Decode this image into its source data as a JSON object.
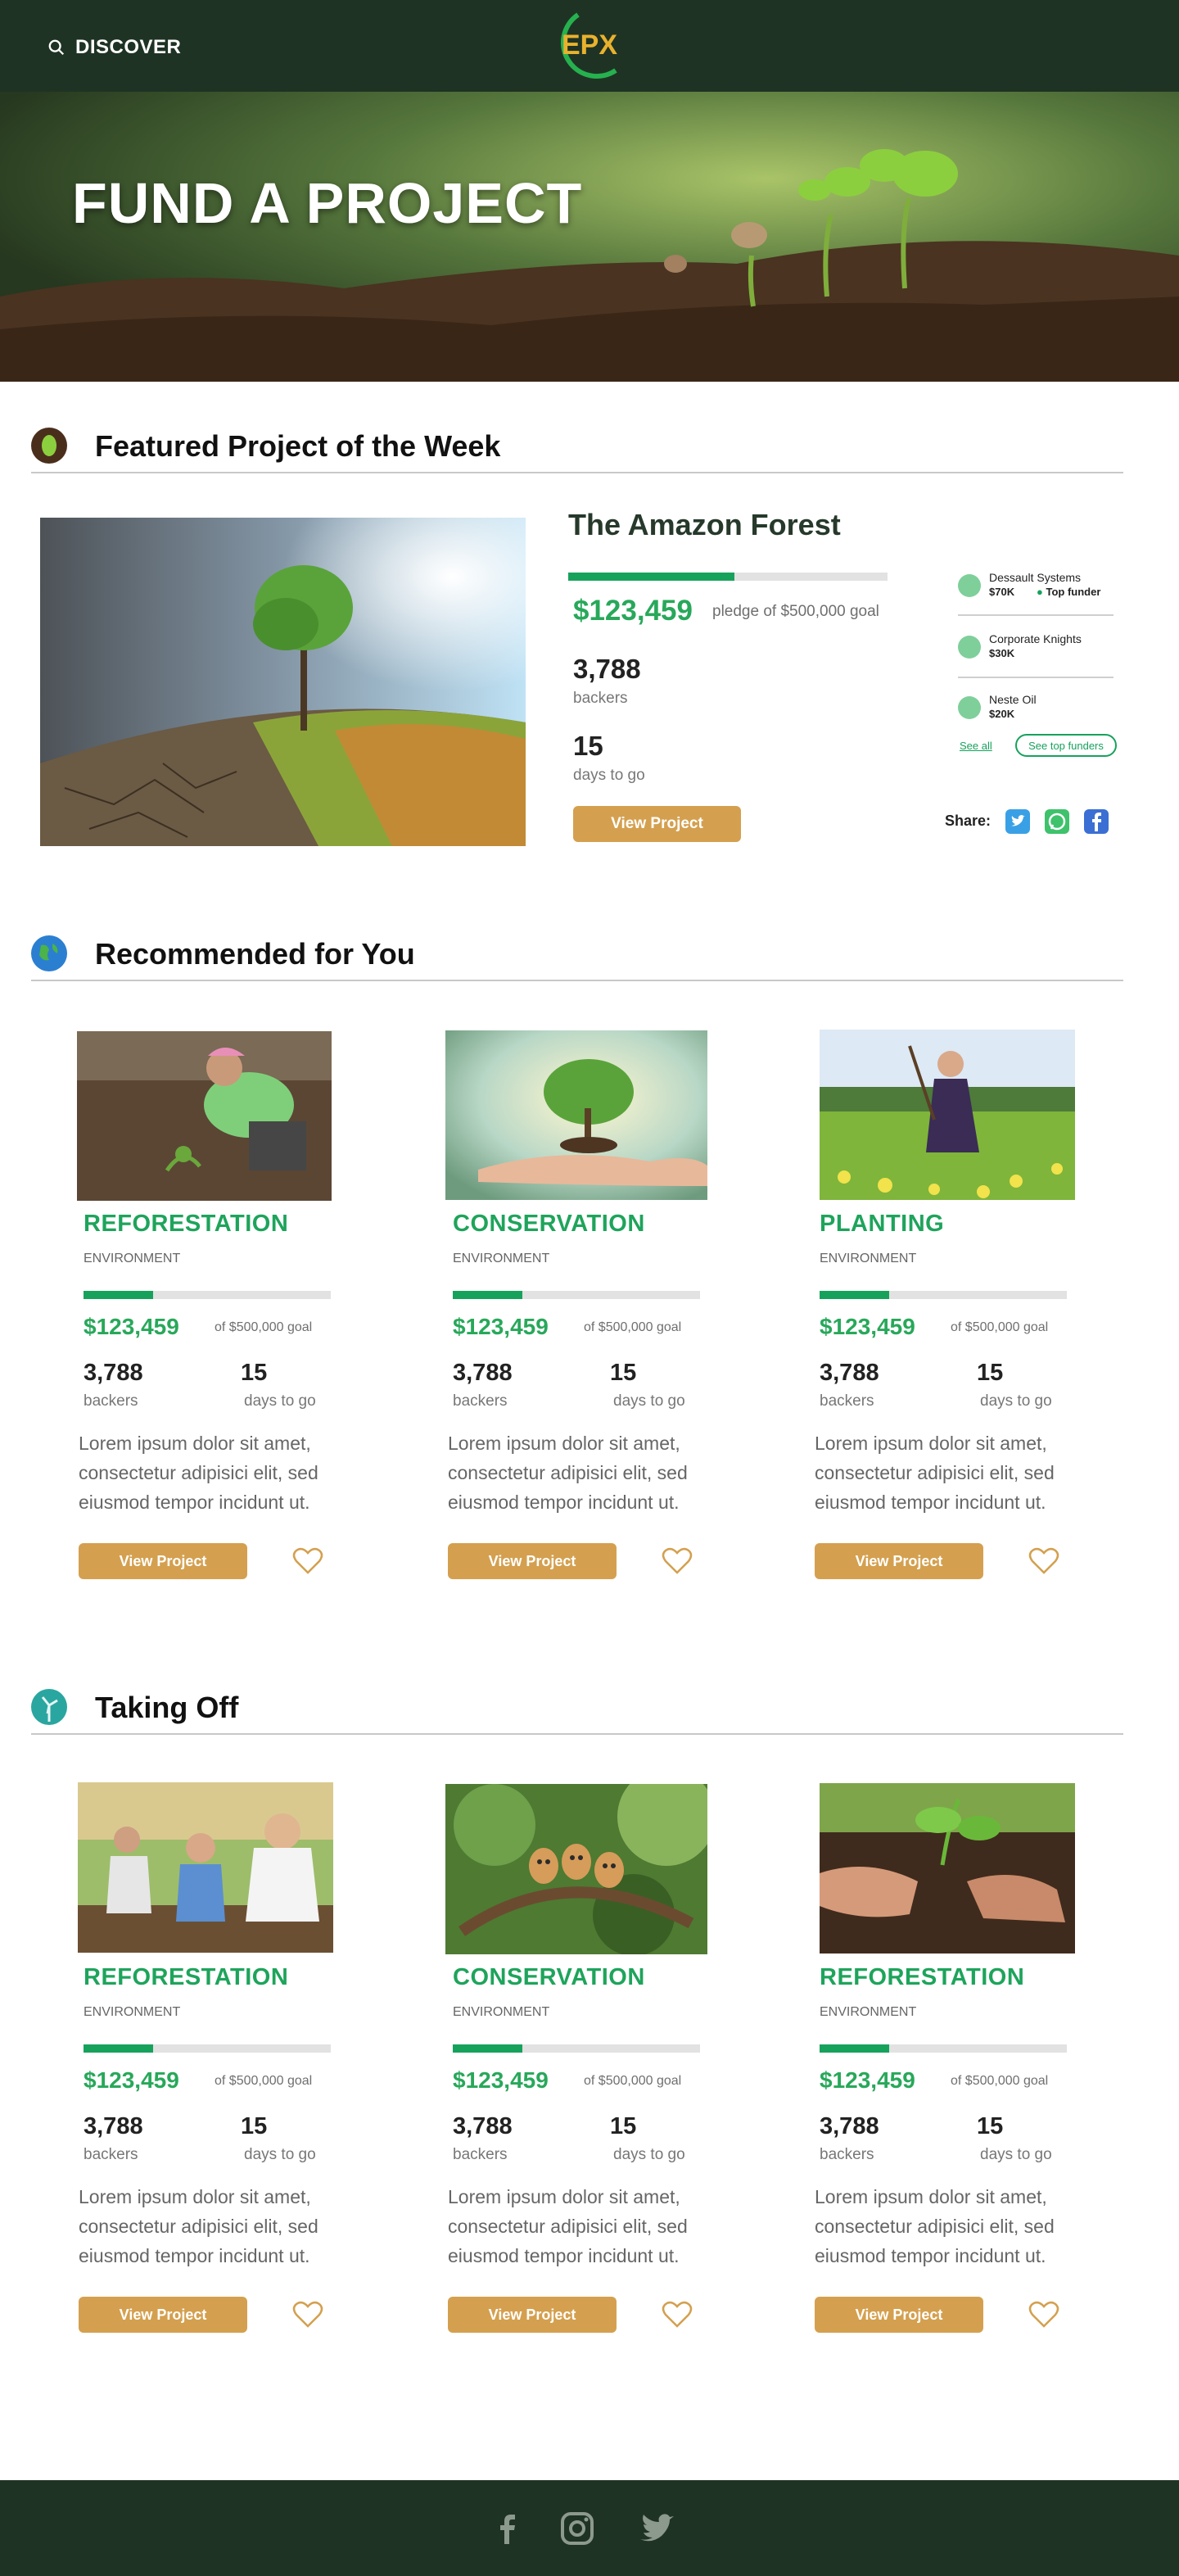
{
  "header": {
    "discover_label": "DISCOVER",
    "logo_text": "EPX"
  },
  "hero": {
    "title": "FUND A PROJECT"
  },
  "featured": {
    "section_title": "Featured Project of the Week",
    "project_title": "The Amazon Forest",
    "amount": "$123,459",
    "goal_text": "pledge of $500,000 goal",
    "progress": 0.52,
    "backers": "3,788",
    "backers_label": "backers",
    "days": "15",
    "days_label": "days to go",
    "view_label": "View Project",
    "funders": [
      {
        "name": "Dessault Systems",
        "amount": "$70K",
        "tag": "Top funder"
      },
      {
        "name": "Corporate Knights",
        "amount": "$30K"
      },
      {
        "name": "Neste Oil",
        "amount": "$20K"
      }
    ],
    "see_all": "See all",
    "see_top": "See top funders",
    "share_label": "Share:"
  },
  "recommended": {
    "section_title": "Recommended for You",
    "cards": [
      {
        "category": "REFORESTATION",
        "sub": "ENVIRONMENT",
        "amount": "$123,459",
        "goal": "of $500,000 goal",
        "progress": 0.28,
        "backers": "3,788",
        "backers_label": "backers",
        "days": "15",
        "days_label": "days to go",
        "desc": "Lorem ipsum dolor sit amet, consectetur adipisici elit, sed eiusmod tempor incidunt ut.",
        "button": "View Project"
      },
      {
        "category": "CONSERVATION",
        "sub": "ENVIRONMENT",
        "amount": "$123,459",
        "goal": "of $500,000 goal",
        "progress": 0.28,
        "backers": "3,788",
        "backers_label": "backers",
        "days": "15",
        "days_label": "days to go",
        "desc": "Lorem ipsum dolor sit amet, consectetur adipisici elit, sed eiusmod tempor incidunt ut.",
        "button": "View Project"
      },
      {
        "category": "PLANTING",
        "sub": "ENVIRONMENT",
        "amount": "$123,459",
        "goal": "of $500,000 goal",
        "progress": 0.28,
        "backers": "3,788",
        "backers_label": "backers",
        "days": "15",
        "days_label": "days to go",
        "desc": "Lorem ipsum dolor sit amet, consectetur adipisici elit, sed eiusmod tempor incidunt ut.",
        "button": "View Project"
      }
    ]
  },
  "taking_off": {
    "section_title": "Taking Off",
    "cards": [
      {
        "category": "REFORESTATION",
        "sub": "ENVIRONMENT",
        "amount": "$123,459",
        "goal": "of $500,000 goal",
        "progress": 0.28,
        "backers": "3,788",
        "backers_label": "backers",
        "days": "15",
        "days_label": "days to go",
        "desc": "Lorem ipsum dolor sit amet, consectetur adipisici elit, sed eiusmod tempor incidunt ut.",
        "button": "View Project"
      },
      {
        "category": "CONSERVATION",
        "sub": "ENVIRONMENT",
        "amount": "$123,459",
        "goal": "of $500,000 goal",
        "progress": 0.28,
        "backers": "3,788",
        "backers_label": "backers",
        "days": "15",
        "days_label": "days to go",
        "desc": "Lorem ipsum dolor sit amet, consectetur adipisici elit, sed eiusmod tempor incidunt ut.",
        "button": "View Project"
      },
      {
        "category": "REFORESTATION",
        "sub": "ENVIRONMENT",
        "amount": "$123,459",
        "goal": "of $500,000 goal",
        "progress": 0.28,
        "backers": "3,788",
        "backers_label": "backers",
        "days": "15",
        "days_label": "days to go",
        "desc": "Lorem ipsum dolor sit amet, consectetur adipisici elit, sed eiusmod tempor incidunt ut.",
        "button": "View Project"
      }
    ]
  },
  "colors": {
    "header_bg": "#1f3324",
    "accent_green": "#17a25c",
    "button_gold": "#d4a04f",
    "logo_gold": "#e8b22e"
  }
}
